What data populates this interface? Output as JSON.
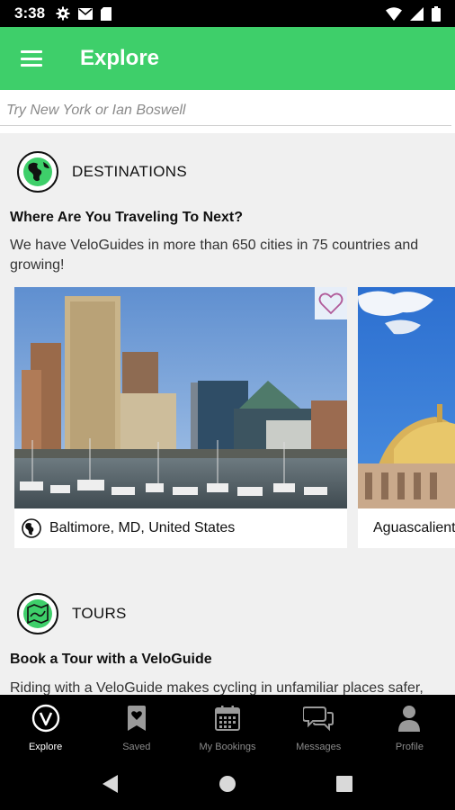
{
  "status_bar": {
    "time": "3:38"
  },
  "app_bar": {
    "title": "Explore"
  },
  "search": {
    "placeholder": "Try New York or Ian Boswell"
  },
  "destinations": {
    "title": "DESTINATIONS",
    "heading": "Where Are You Traveling To Next?",
    "description": "We have VeloGuides in more than 650 cities in 75 countries and growing!",
    "cards": [
      {
        "place": "Baltimore, MD, United States"
      },
      {
        "place": "Aguascalientes"
      }
    ]
  },
  "tours": {
    "title": "TOURS",
    "heading": "Book a Tour with a VeloGuide",
    "description": "Riding with a VeloGuide makes cycling in unfamiliar places safer,"
  },
  "bottom_nav": {
    "items": [
      {
        "label": "Explore",
        "icon": "veloguide-logo-icon",
        "active": true
      },
      {
        "label": "Saved",
        "icon": "bookmark-heart-icon",
        "active": false
      },
      {
        "label": "My Bookings",
        "icon": "calendar-icon",
        "active": false
      },
      {
        "label": "Messages",
        "icon": "chat-bubbles-icon",
        "active": false
      },
      {
        "label": "Profile",
        "icon": "person-icon",
        "active": false
      }
    ]
  },
  "colors": {
    "brand_green": "#3ecf6a",
    "nav_background": "#000000"
  }
}
